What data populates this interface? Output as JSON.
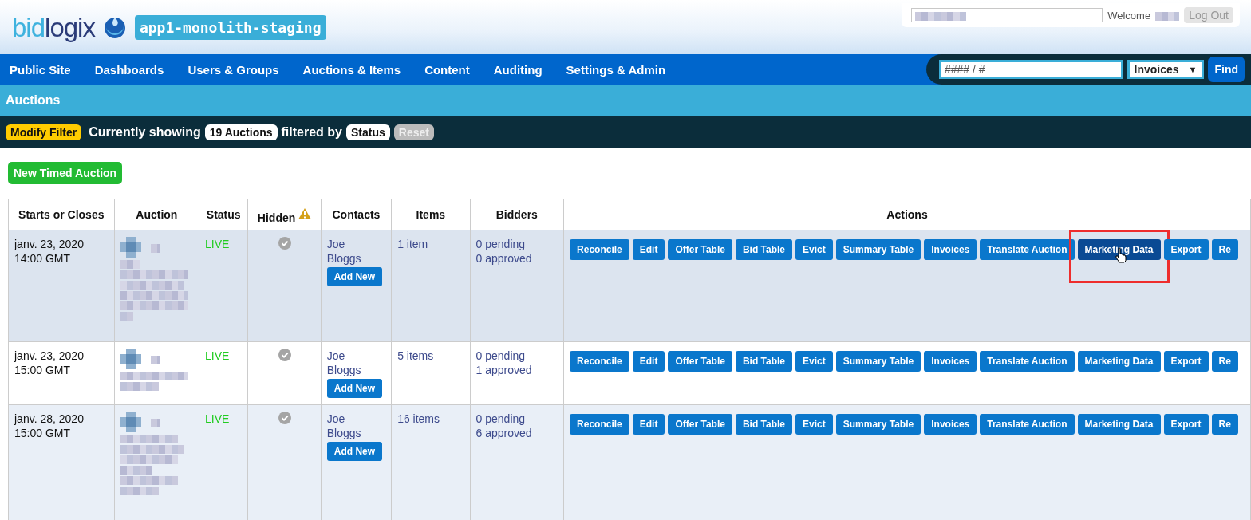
{
  "brand": {
    "logo": [
      "bid",
      "logix"
    ],
    "environment": "app1-monolith-staging"
  },
  "user_panel": {
    "welcome": "Welcome",
    "logout": "Log Out"
  },
  "nav": {
    "items": [
      "Public Site",
      "Dashboards",
      "Users & Groups",
      "Auctions & Items",
      "Content",
      "Auditing",
      "Settings & Admin"
    ]
  },
  "search": {
    "placeholder": "#### / #",
    "type": "Invoices",
    "arrow": "▼",
    "button": "Find"
  },
  "page_title": "Auctions",
  "filter": {
    "modify": "Modify Filter",
    "showing": "Currently showing",
    "count": "19 Auctions",
    "filtered_by": "filtered by",
    "field": "Status",
    "reset": "Reset"
  },
  "new_button": "New Timed Auction",
  "table": {
    "columns": [
      "Starts or Closes",
      "Auction",
      "Status",
      "Hidden",
      "Contacts",
      "Items",
      "Bidders",
      "Actions"
    ],
    "rows": [
      {
        "date": "janv. 23, 2020",
        "time": "14:00 GMT",
        "status": "LIVE",
        "contact_first": "Joe",
        "contact_last": "Bloggs",
        "add_new": "Add New",
        "items": "1 item",
        "pending": "0 pending",
        "approved": "0 approved",
        "actions": [
          {
            "label": "Reconcile",
            "hovered": false
          },
          {
            "label": "Edit",
            "hovered": false
          },
          {
            "label": "Offer Table",
            "hovered": false
          },
          {
            "label": "Bid Table",
            "hovered": false
          },
          {
            "label": "Evict",
            "hovered": false
          },
          {
            "label": "Summary Table",
            "hovered": false
          },
          {
            "label": "Invoices",
            "hovered": false
          },
          {
            "label": "Translate Auction",
            "hovered": false
          },
          {
            "label": "Marketing Data",
            "hovered": true
          },
          {
            "label": "Export",
            "hovered": false
          },
          {
            "label": "Re",
            "hovered": false
          }
        ]
      },
      {
        "date": "janv. 23, 2020",
        "time": "15:00 GMT",
        "status": "LIVE",
        "contact_first": "Joe",
        "contact_last": "Bloggs",
        "add_new": "Add New",
        "items": "5 items",
        "pending": "0 pending",
        "approved": "1 approved",
        "actions": [
          {
            "label": "Reconcile",
            "hovered": false
          },
          {
            "label": "Edit",
            "hovered": false
          },
          {
            "label": "Offer Table",
            "hovered": false
          },
          {
            "label": "Bid Table",
            "hovered": false
          },
          {
            "label": "Evict",
            "hovered": false
          },
          {
            "label": "Summary Table",
            "hovered": false
          },
          {
            "label": "Invoices",
            "hovered": false
          },
          {
            "label": "Translate Auction",
            "hovered": false
          },
          {
            "label": "Marketing Data",
            "hovered": false
          },
          {
            "label": "Export",
            "hovered": false
          },
          {
            "label": "Re",
            "hovered": false
          }
        ]
      },
      {
        "date": "janv. 28, 2020",
        "time": "15:00 GMT",
        "status": "LIVE",
        "contact_first": "Joe",
        "contact_last": "Bloggs",
        "add_new": "Add New",
        "items": "16 items",
        "pending": "0 pending",
        "approved": "6 approved",
        "actions": [
          {
            "label": "Reconcile",
            "hovered": false
          },
          {
            "label": "Edit",
            "hovered": false
          },
          {
            "label": "Offer Table",
            "hovered": false
          },
          {
            "label": "Bid Table",
            "hovered": false
          },
          {
            "label": "Evict",
            "hovered": false
          },
          {
            "label": "Summary Table",
            "hovered": false
          },
          {
            "label": "Invoices",
            "hovered": false
          },
          {
            "label": "Translate Auction",
            "hovered": false
          },
          {
            "label": "Marketing Data",
            "hovered": false
          },
          {
            "label": "Export",
            "hovered": false
          },
          {
            "label": "Re",
            "hovered": false
          }
        ]
      }
    ]
  }
}
